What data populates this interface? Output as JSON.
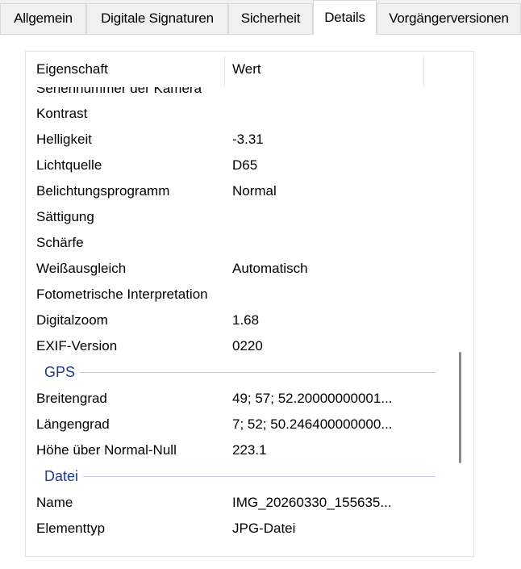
{
  "tabs": [
    {
      "label": "Allgemein"
    },
    {
      "label": "Digitale Signaturen"
    },
    {
      "label": "Sicherheit"
    },
    {
      "label": "Details"
    },
    {
      "label": "Vorgängerversionen"
    }
  ],
  "list": {
    "columns": {
      "property": "Eigenschaft",
      "value": "Wert"
    },
    "partial_row": {
      "name": "Seriennummer der Kamera",
      "value": ""
    },
    "rows": [
      {
        "name": "Kontrast",
        "value": ""
      },
      {
        "name": "Helligkeit",
        "value": "-3.31"
      },
      {
        "name": "Lichtquelle",
        "value": "D65"
      },
      {
        "name": "Belichtungsprogramm",
        "value": "Normal"
      },
      {
        "name": "Sättigung",
        "value": ""
      },
      {
        "name": "Schärfe",
        "value": ""
      },
      {
        "name": "Weißausgleich",
        "value": "Automatisch"
      },
      {
        "name": "Fotometrische Interpretation",
        "value": ""
      },
      {
        "name": "Digitalzoom",
        "value": "1.68"
      },
      {
        "name": "EXIF-Version",
        "value": "0220"
      }
    ],
    "gps_group": {
      "label": "GPS",
      "rows": [
        {
          "name": "Breitengrad",
          "value": "49; 57; 52.20000000001..."
        },
        {
          "name": "Längengrad",
          "value": "7; 52; 50.246400000000..."
        },
        {
          "name": "Höhe über Normal-Null",
          "value": "223.1"
        }
      ]
    },
    "file_group": {
      "label": "Datei",
      "rows": [
        {
          "name": "Name",
          "value": "IMG_20260330_155635..."
        },
        {
          "name": "Elementtyp",
          "value": "JPG-Datei"
        }
      ]
    }
  },
  "colors": {
    "group_label": "#1e3a8a",
    "scroll_thumb": "#8a8a8a"
  }
}
